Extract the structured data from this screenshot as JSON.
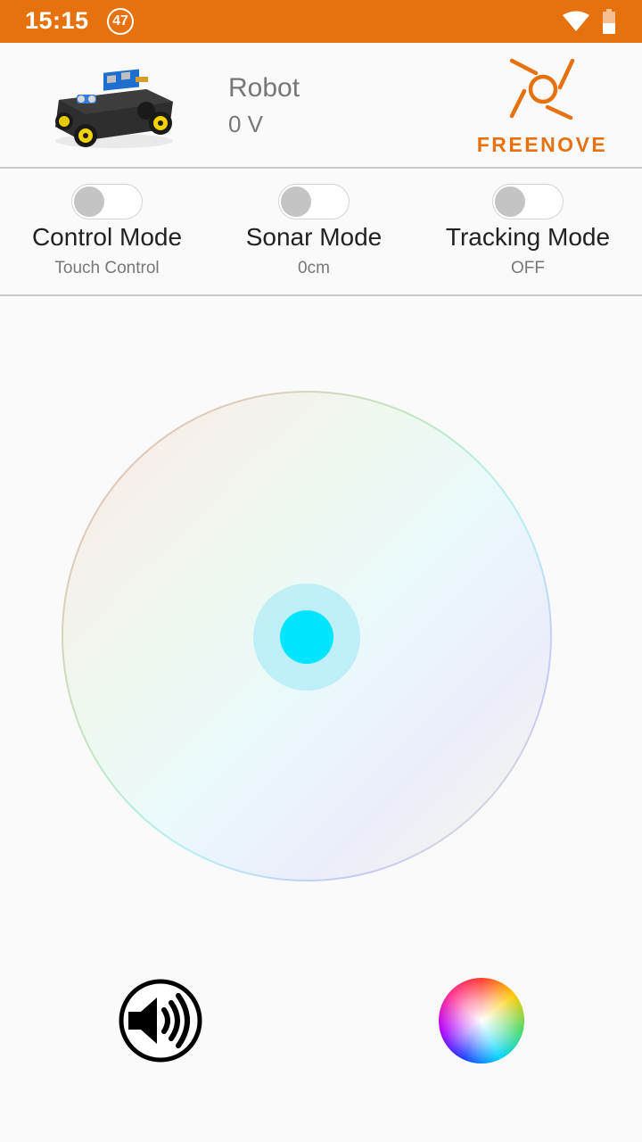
{
  "status_bar": {
    "time": "15:15",
    "notification_badge": "47",
    "icons": [
      "wifi-icon",
      "battery-icon"
    ],
    "background_color": "#e6720f"
  },
  "header": {
    "robot_name": "Robot",
    "voltage": "0 V",
    "brand": "FREENOVE",
    "brand_color": "#e6720f"
  },
  "modes": [
    {
      "title": "Control Mode",
      "status": "Touch Control",
      "enabled": false
    },
    {
      "title": "Sonar Mode",
      "status": "0cm",
      "enabled": false
    },
    {
      "title": "Tracking Mode",
      "status": "OFF",
      "enabled": false
    }
  ],
  "joystick": {
    "knob_color": "#00e5ff",
    "knob_x": 0,
    "knob_y": 0
  },
  "bottom_controls": {
    "left_icon": "speaker-icon",
    "right_icon": "color-wheel-icon"
  }
}
